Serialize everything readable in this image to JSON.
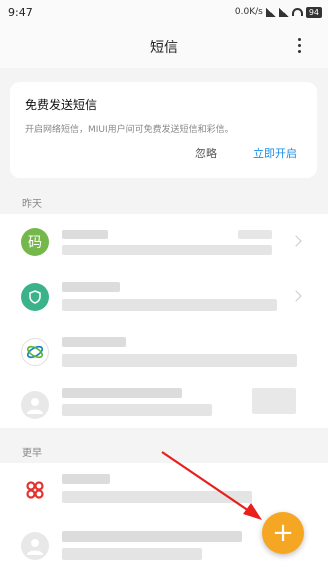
{
  "status_bar": {
    "time": "9:47",
    "network_speed": "0.0K/s",
    "battery": "94"
  },
  "header": {
    "title": "短信"
  },
  "promo_card": {
    "title": "免费发送短信",
    "description": "开启网络短信，MIUI用户间可免费发送短信和彩信。",
    "ignore_label": "忽略",
    "enable_label": "立即开启"
  },
  "sections": {
    "yesterday": "昨天",
    "earlier": "更早"
  },
  "conversations": [
    {
      "avatar_text": "码",
      "avatar_color": "#74b84c",
      "avatar_icon": "text-avatar"
    },
    {
      "avatar_text": "",
      "avatar_color": "#3bb38a",
      "avatar_icon": "shield-icon"
    },
    {
      "avatar_text": "",
      "avatar_color": "#ffffff",
      "avatar_icon": "china-mobile-logo"
    },
    {
      "avatar_text": "",
      "avatar_color": "#e8e8e8",
      "avatar_icon": "person-icon"
    },
    {
      "avatar_text": "",
      "avatar_color": "#ffffff",
      "avatar_icon": "china-unicom-logo"
    },
    {
      "avatar_text": "",
      "avatar_color": "#e8e8e8",
      "avatar_icon": "person-icon"
    }
  ],
  "fab": {
    "label": "+",
    "icon": "plus-icon",
    "color": "#f5a623"
  }
}
